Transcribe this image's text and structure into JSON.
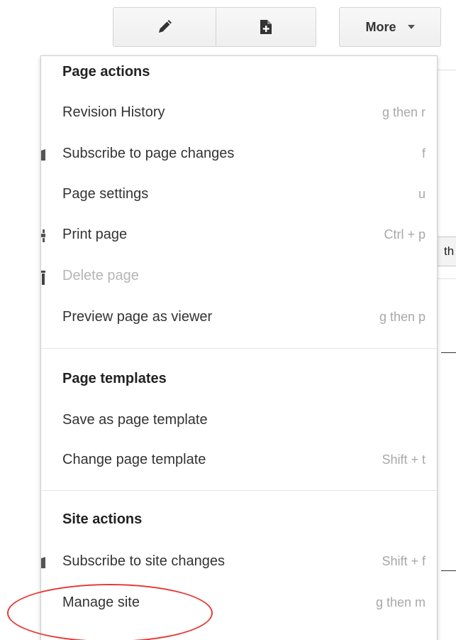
{
  "toolbar": {
    "edit_icon": "pencil-icon",
    "new_page_icon": "new-page-icon",
    "more_label": "More",
    "more_icon": "caret-down-icon"
  },
  "background": {
    "tab_text": "th"
  },
  "menu": {
    "sections": [
      {
        "heading": "Page actions",
        "items": [
          {
            "label": "Revision History",
            "shortcut": "g then r",
            "icon": ""
          },
          {
            "label": "Subscribe to page changes",
            "shortcut": "f",
            "icon": "subscribe-icon"
          },
          {
            "label": "Page settings",
            "shortcut": "u",
            "icon": ""
          },
          {
            "label": "Print page",
            "shortcut": "Ctrl + p",
            "icon": "print-icon"
          },
          {
            "label": "Delete page",
            "shortcut": "",
            "icon": "trash-icon",
            "disabled": true
          },
          {
            "label": "Preview page as viewer",
            "shortcut": "g then p",
            "icon": ""
          }
        ]
      },
      {
        "heading": "Page templates",
        "items": [
          {
            "label": "Save as page template",
            "shortcut": ""
          },
          {
            "label": "Change page template",
            "shortcut": "Shift + t"
          }
        ]
      },
      {
        "heading": "Site actions",
        "items": [
          {
            "label": "Subscribe to site changes",
            "shortcut": "Shift + f",
            "icon": "subscribe-icon"
          },
          {
            "label": "Manage site",
            "shortcut": "g then m"
          }
        ]
      }
    ]
  },
  "annotation": {
    "color": "#e53935",
    "target": "Manage site"
  }
}
